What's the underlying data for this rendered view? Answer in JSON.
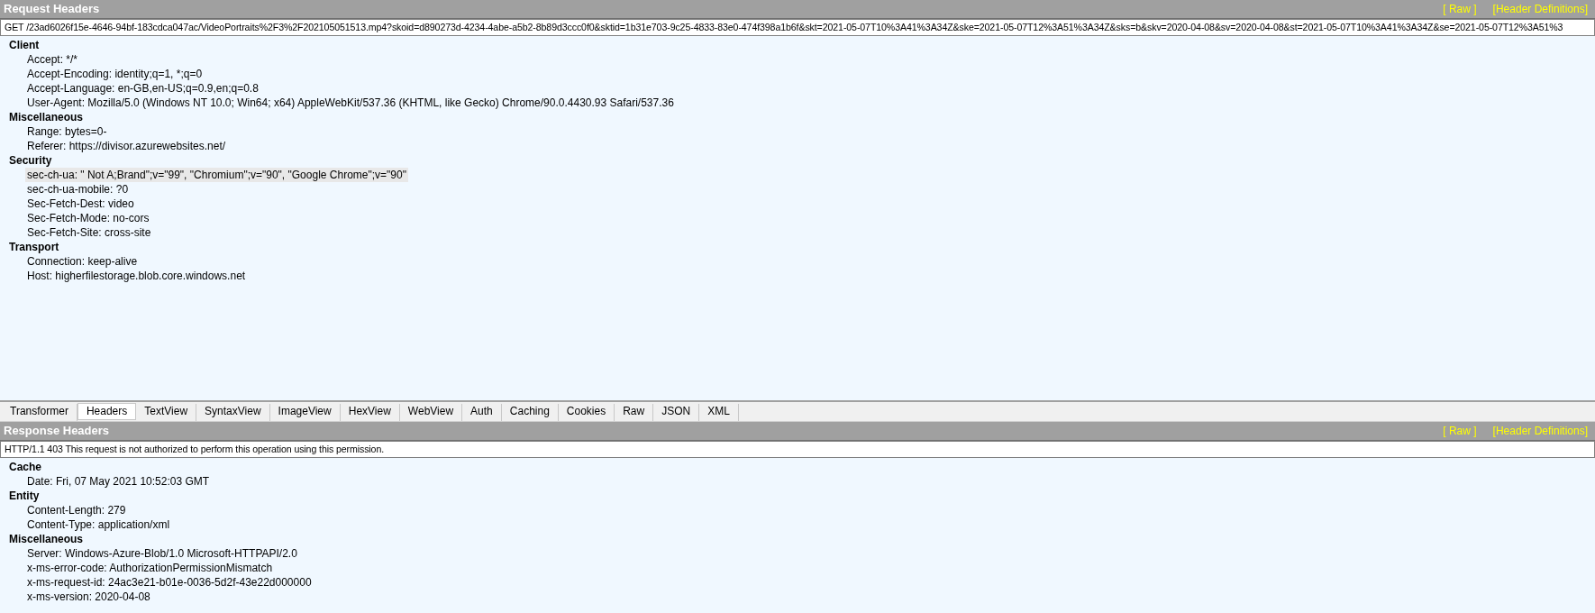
{
  "request": {
    "title": "Request Headers",
    "links": [
      "[ Raw ]",
      "[Header Definitions]"
    ],
    "request_line": "GET /23ad6026f15e-4646-94bf-183cdca047ac/VideoPortraits%2F3%2F202105051513.mp4?skoid=d890273d-4234-4abe-a5b2-8b89d3ccc0f0&sktid=1b31e703-9c25-4833-83e0-474f398a1b6f&skt=2021-05-07T10%3A41%3A34Z&ske=2021-05-07T12%3A51%3A34Z&sks=b&skv=2020-04-08&sv=2020-04-08&st=2021-05-07T10%3A41%3A34Z&se=2021-05-07T12%3A51%3",
    "groups": [
      {
        "name": "Client",
        "headers": [
          {
            "text": "Accept: */*",
            "selected": false
          },
          {
            "text": "Accept-Encoding: identity;q=1, *;q=0",
            "selected": false
          },
          {
            "text": "Accept-Language: en-GB,en-US;q=0.9,en;q=0.8",
            "selected": false
          },
          {
            "text": "User-Agent: Mozilla/5.0 (Windows NT 10.0; Win64; x64) AppleWebKit/537.36 (KHTML, like Gecko) Chrome/90.0.4430.93 Safari/537.36",
            "selected": false
          }
        ]
      },
      {
        "name": "Miscellaneous",
        "headers": [
          {
            "text": "Range: bytes=0-",
            "selected": false
          },
          {
            "text": "Referer: https://divisor.azurewebsites.net/",
            "selected": false
          }
        ]
      },
      {
        "name": "Security",
        "headers": [
          {
            "text": "sec-ch-ua: \" Not A;Brand\";v=\"99\", \"Chromium\";v=\"90\", \"Google Chrome\";v=\"90\"",
            "selected": true
          },
          {
            "text": "sec-ch-ua-mobile: ?0",
            "selected": false
          },
          {
            "text": "Sec-Fetch-Dest: video",
            "selected": false
          },
          {
            "text": "Sec-Fetch-Mode: no-cors",
            "selected": false
          },
          {
            "text": "Sec-Fetch-Site: cross-site",
            "selected": false
          }
        ]
      },
      {
        "name": "Transport",
        "headers": [
          {
            "text": "Connection: keep-alive",
            "selected": false
          },
          {
            "text": "Host: higherfilestorage.blob.core.windows.net",
            "selected": false
          }
        ]
      }
    ]
  },
  "tabs": [
    {
      "label": "Transformer",
      "selected": false
    },
    {
      "label": "Headers",
      "selected": true
    },
    {
      "label": "TextView",
      "selected": false
    },
    {
      "label": "SyntaxView",
      "selected": false
    },
    {
      "label": "ImageView",
      "selected": false
    },
    {
      "label": "HexView",
      "selected": false
    },
    {
      "label": "WebView",
      "selected": false
    },
    {
      "label": "Auth",
      "selected": false
    },
    {
      "label": "Caching",
      "selected": false
    },
    {
      "label": "Cookies",
      "selected": false
    },
    {
      "label": "Raw",
      "selected": false
    },
    {
      "label": "JSON",
      "selected": false
    },
    {
      "label": "XML",
      "selected": false
    }
  ],
  "response": {
    "title": "Response Headers",
    "links": [
      "[ Raw ]",
      "[Header Definitions]"
    ],
    "request_line": "HTTP/1.1 403 This request is not authorized to perform this operation using this permission.",
    "groups": [
      {
        "name": "Cache",
        "headers": [
          {
            "text": "Date: Fri, 07 May 2021 10:52:03 GMT",
            "selected": false
          }
        ]
      },
      {
        "name": "Entity",
        "headers": [
          {
            "text": "Content-Length: 279",
            "selected": false
          },
          {
            "text": "Content-Type: application/xml",
            "selected": false
          }
        ]
      },
      {
        "name": "Miscellaneous",
        "headers": [
          {
            "text": "Server: Windows-Azure-Blob/1.0 Microsoft-HTTPAPI/2.0",
            "selected": false
          },
          {
            "text": "x-ms-error-code: AuthorizationPermissionMismatch",
            "selected": false
          },
          {
            "text": "x-ms-request-id: 24ac3e21-b01e-0036-5d2f-43e22d000000",
            "selected": false
          },
          {
            "text": "x-ms-version: 2020-04-08",
            "selected": false
          }
        ]
      }
    ]
  }
}
